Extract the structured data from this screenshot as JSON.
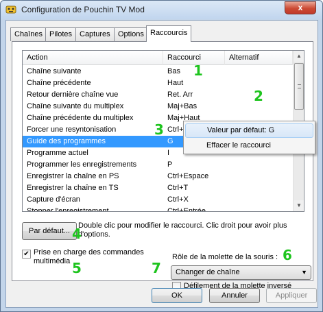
{
  "window": {
    "title": "Configuration de Pouchin TV Mod",
    "close_label": "x"
  },
  "tabs": [
    {
      "label": "Chaînes"
    },
    {
      "label": "Pilotes"
    },
    {
      "label": "Captures"
    },
    {
      "label": "Options"
    },
    {
      "label": "Raccourcis"
    }
  ],
  "shortcuts_table": {
    "columns": [
      "Action",
      "Raccourci",
      "Alternatif"
    ],
    "rows": [
      {
        "action": "Chaîne suivante",
        "shortcut": "Bas",
        "alt": ""
      },
      {
        "action": "Chaîne précédente",
        "shortcut": "Haut",
        "alt": ""
      },
      {
        "action": "Retour dernière chaîne vue",
        "shortcut": "Ret. Arr",
        "alt": ""
      },
      {
        "action": "Chaîne suivante du multiplex",
        "shortcut": "Maj+Bas",
        "alt": ""
      },
      {
        "action": "Chaîne précédente du multiplex",
        "shortcut": "Maj+Haut",
        "alt": ""
      },
      {
        "action": "Forcer une resyntonisation",
        "shortcut": "Ctrl+F",
        "alt": ""
      },
      {
        "action": "Guide des programmes",
        "shortcut": "G",
        "alt": ""
      },
      {
        "action": "Programme actuel",
        "shortcut": "I",
        "alt": ""
      },
      {
        "action": "Programmer les enregistrements",
        "shortcut": "P",
        "alt": ""
      },
      {
        "action": "Enregistrer la chaîne en PS",
        "shortcut": "Ctrl+Espace",
        "alt": ""
      },
      {
        "action": "Enregistrer la chaîne en TS",
        "shortcut": "Ctrl+T",
        "alt": ""
      },
      {
        "action": "Capture d'écran",
        "shortcut": "Ctrl+X",
        "alt": ""
      },
      {
        "action": "Stopper l'enregistrement",
        "shortcut": "Ctrl+Entrée",
        "alt": ""
      }
    ],
    "selected_index": 6
  },
  "context_menu": {
    "items": [
      {
        "label": "Valeur par défaut: G"
      },
      {
        "label": "Effacer le raccourci"
      }
    ]
  },
  "controls": {
    "default_button": "Par défaut...",
    "help_text": "Double clic pour modifier le raccourci. Clic droit pour avoir plus d'options.",
    "multimedia_checkbox_label": "Prise en charge des commandes multimédia",
    "multimedia_checked": true,
    "mouse_wheel_label": "Rôle de la molette de la souris :",
    "mouse_wheel_value": "Changer de chaîne",
    "inverse_scroll_label": "Défilement de la molette inversé",
    "inverse_scroll_checked": false
  },
  "footer": {
    "ok": "OK",
    "cancel": "Annuler",
    "apply": "Appliquer"
  },
  "annotations": [
    "1",
    "2",
    "3",
    "4",
    "5",
    "6",
    "7"
  ],
  "colors": {
    "selection": "#3399ff",
    "annotation": "#1ec41e",
    "close_button": "#c0392b"
  }
}
